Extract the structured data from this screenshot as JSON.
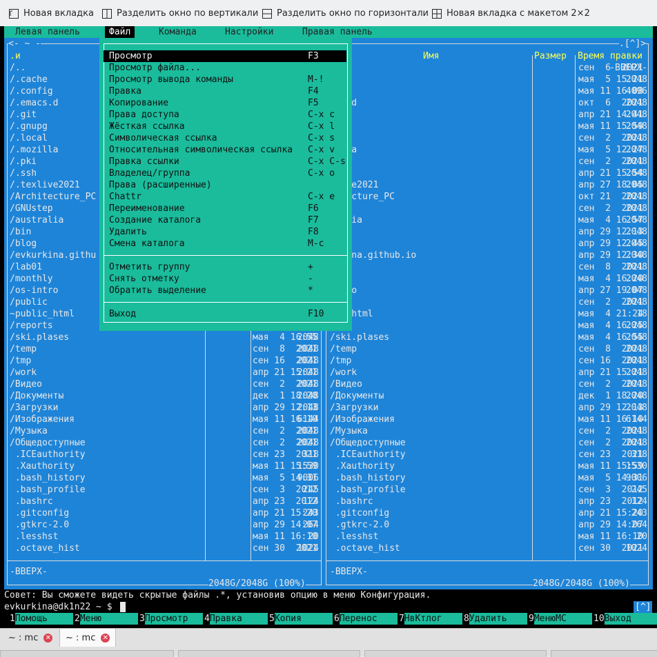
{
  "toolbar": {
    "new_tab": "Новая вкладка",
    "split_vertical": "Разделить окно по вертикали",
    "split_horizontal": "Разделить окно по горизонтали",
    "new_tab_layout": "Новая вкладка с макетом 2×2"
  },
  "menubar": {
    "left_panel": "Левая панель",
    "file": "Файл",
    "command": "Команда",
    "settings": "Настройки",
    "right_panel": "Правая панель"
  },
  "file_menu": [
    {
      "label": "Просмотр",
      "key": "F3"
    },
    {
      "label": "Просмотр файла...",
      "key": ""
    },
    {
      "label": "Просмотр вывода команды",
      "key": "M-!"
    },
    {
      "label": "Правка",
      "key": "F4"
    },
    {
      "label": "Копирование",
      "key": "F5"
    },
    {
      "label": "Права доступа",
      "key": "C-x c"
    },
    {
      "label": "Жёсткая ссылка",
      "key": "C-x l"
    },
    {
      "label": "Символическая ссылка",
      "key": "C-x s"
    },
    {
      "label": "Относительная символическая ссылка",
      "key": "C-x v"
    },
    {
      "label": "Правка ссылки",
      "key": "C-x C-s"
    },
    {
      "label": "Владелец/группа",
      "key": "C-x o"
    },
    {
      "label": "Права (расширенные)",
      "key": ""
    },
    {
      "label": "Chattr",
      "key": "C-x e"
    },
    {
      "label": "Переименование",
      "key": "F6"
    },
    {
      "label": "Создание каталога",
      "key": "F7"
    },
    {
      "label": "Удалить",
      "key": "F8"
    },
    {
      "label": "Смена каталога",
      "key": "M-c"
    },
    {
      "label": "Отметить группу",
      "key": "+"
    },
    {
      "label": "Снять отметку",
      "key": "-"
    },
    {
      "label": "Обратить выделение",
      "key": "*"
    },
    {
      "label": "Выход",
      "key": "F10"
    }
  ],
  "left_panel": {
    "path": "~",
    "name_header": ".и",
    "entries": [
      {
        "name": "/..",
        "size": "",
        "date": ""
      },
      {
        "name": "/.cache",
        "size": "",
        "date": ""
      },
      {
        "name": "/.config",
        "size": "",
        "date": ""
      },
      {
        "name": "/.emacs.d",
        "size": "",
        "date": ""
      },
      {
        "name": "/.git",
        "size": "",
        "date": ""
      },
      {
        "name": "/.gnupg",
        "size": "",
        "date": ""
      },
      {
        "name": "/.local",
        "size": "",
        "date": ""
      },
      {
        "name": "/.mozilla",
        "size": "",
        "date": ""
      },
      {
        "name": "/.pki",
        "size": "",
        "date": ""
      },
      {
        "name": "/.ssh",
        "size": "",
        "date": ""
      },
      {
        "name": "/.texlive2021",
        "size": "",
        "date": ""
      },
      {
        "name": "/Architecture_PC",
        "size": "",
        "date": ""
      },
      {
        "name": "/GNUstep",
        "size": "",
        "date": ""
      },
      {
        "name": "/australia",
        "size": "",
        "date": ""
      },
      {
        "name": "/bin",
        "size": "",
        "date": ""
      },
      {
        "name": "/blog",
        "size": "",
        "date": ""
      },
      {
        "name": "/evkurkina.githu",
        "size": "",
        "date": ""
      },
      {
        "name": "/lab01",
        "size": "",
        "date": ""
      },
      {
        "name": "/monthly",
        "size": "",
        "date": ""
      },
      {
        "name": "/os-intro",
        "size": "",
        "date": ""
      },
      {
        "name": "/public",
        "size": "",
        "date": ""
      },
      {
        "name": "~public_html",
        "size": "",
        "date": ""
      },
      {
        "name": "/reports",
        "size": "",
        "date": ""
      },
      {
        "name": "/ski.plases",
        "size": "2048",
        "date": "мая  4 16:55"
      },
      {
        "name": "/temp",
        "size": "2048",
        "date": "сен  8  2021"
      },
      {
        "name": "/tmp",
        "size": "2048",
        "date": "сен 16  2021"
      },
      {
        "name": "/work",
        "size": "2048",
        "date": "апр 21 15:21"
      },
      {
        "name": "/Видео",
        "size": "2048",
        "date": "сен  2  2021"
      },
      {
        "name": "/Документы",
        "size": "2048",
        "date": "дек  1 18:20"
      },
      {
        "name": "/Загрузки",
        "size": "2048",
        "date": "апр 29 12:13"
      },
      {
        "name": "/Изображения",
        "size": "6144",
        "date": "мая 11 16:10"
      },
      {
        "name": "/Музыка",
        "size": "2048",
        "date": "сен  2  2021"
      },
      {
        "name": "/Общедоступные",
        "size": "2048",
        "date": "сен  2  2021"
      },
      {
        "name": " .ICEauthority",
        "size": "318",
        "date": "сен 23  2021"
      },
      {
        "name": " .Xauthority",
        "size": "1530",
        "date": "мая 11 15:59"
      },
      {
        "name": " .bash_history",
        "size": "9006",
        "date": "мая  5 14:31"
      },
      {
        "name": " .bash_profile",
        "size": "245",
        "date": "сен  3  2012"
      },
      {
        "name": " .bashrc",
        "size": "124",
        "date": "апр 23  2012"
      },
      {
        "name": " .gitconfig",
        "size": "243",
        "date": "апр 21 15:20"
      },
      {
        "name": " .gtkrc-2.0",
        "size": "264",
        "date": "апр 29 14:07"
      },
      {
        "name": " .lesshst",
        "size": "20",
        "date": "мая 11 16:10"
      },
      {
        "name": " .octave_hist",
        "size": "1024",
        "date": "сен 30  2021"
      }
    ],
    "status": "-ВВЕРХ-",
    "disk": "2048G/2048G (100%)"
  },
  "right_panel": {
    "path_marker": ".[^]>",
    "col_name": "Имя",
    "col_size": "Размер",
    "col_time": "Время правки",
    "entries": [
      {
        "name": "",
        "size": "-ВВЕРХ-",
        "date": "сен  6  2021"
      },
      {
        "name": "che",
        "size": "2048",
        "date": "мая  5 15:21"
      },
      {
        "name": "nfig",
        "size": "4096",
        "date": "мая 11 16:08"
      },
      {
        "name": "acs.d",
        "size": "2048",
        "date": "окт  6  2021"
      },
      {
        "name": "t",
        "size": "2048",
        "date": "апр 21 14:41"
      },
      {
        "name": "upg",
        "size": "2048",
        "date": "мая 11 15:59"
      },
      {
        "name": "cal",
        "size": "2048",
        "date": "сен  2  2021"
      },
      {
        "name": "zilla",
        "size": "2048",
        "date": "мая  5 12:27"
      },
      {
        "name": "i",
        "size": "2048",
        "date": "сен  2  2021"
      },
      {
        "name": "h",
        "size": "2048",
        "date": "апр 21 15:54"
      },
      {
        "name": "xlive2021",
        "size": "2048",
        "date": "апр 27 18:05"
      },
      {
        "name": "hitecture_PC",
        "size": "2048",
        "date": "окт 21  2021"
      },
      {
        "name": "step",
        "size": "2048",
        "date": "сен  2  2021"
      },
      {
        "name": "tralia",
        "size": "2048",
        "date": "мая  4 16:57"
      },
      {
        "name": "",
        "size": "2048",
        "date": "апр 29 12:13"
      },
      {
        "name": "g",
        "size": "2048",
        "date": "апр 29 12:45"
      },
      {
        "name": "urkina.github.io",
        "size": "2048",
        "date": "апр 29 12:30"
      },
      {
        "name": "01",
        "size": "2048",
        "date": "сен  8  2021"
      },
      {
        "name": "thly",
        "size": "2048",
        "date": "мая  4 16:20"
      },
      {
        "name": "intro",
        "size": "2048",
        "date": "апр 27 19:07"
      },
      {
        "name": "lic",
        "size": "2048",
        "date": "сен  2  2021"
      },
      {
        "name": "lic_html",
        "size": "18",
        "date": "мая  4 21:24"
      },
      {
        "name": "orts",
        "size": "2048",
        "date": "мая  4 16:25"
      },
      {
        "name": "/ski.plases",
        "size": "2048",
        "date": "мая  4 16:55"
      },
      {
        "name": "/temp",
        "size": "2048",
        "date": "сен  8  2021"
      },
      {
        "name": "/tmp",
        "size": "2048",
        "date": "сен 16  2021"
      },
      {
        "name": "/work",
        "size": "2048",
        "date": "апр 21 15:21"
      },
      {
        "name": "/Видео",
        "size": "2048",
        "date": "сен  2  2021"
      },
      {
        "name": "/Документы",
        "size": "2048",
        "date": "дек  1 18:20"
      },
      {
        "name": "/Загрузки",
        "size": "2048",
        "date": "апр 29 12:13"
      },
      {
        "name": "/Изображения",
        "size": "6144",
        "date": "мая 11 16:10"
      },
      {
        "name": "/Музыка",
        "size": "2048",
        "date": "сен  2  2021"
      },
      {
        "name": "/Общедоступные",
        "size": "2048",
        "date": "сен  2  2021"
      },
      {
        "name": " .ICEauthority",
        "size": "318",
        "date": "сен 23  2021"
      },
      {
        "name": " .Xauthority",
        "size": "1530",
        "date": "мая 11 15:59"
      },
      {
        "name": " .bash_history",
        "size": "9006",
        "date": "мая  5 14:31"
      },
      {
        "name": " .bash_profile",
        "size": "245",
        "date": "сен  3  2012"
      },
      {
        "name": " .bashrc",
        "size": "124",
        "date": "апр 23  2012"
      },
      {
        "name": " .gitconfig",
        "size": "243",
        "date": "апр 21 15:20"
      },
      {
        "name": " .gtkrc-2.0",
        "size": "264",
        "date": "апр 29 14:07"
      },
      {
        "name": " .lesshst",
        "size": "20",
        "date": "мая 11 16:10"
      },
      {
        "name": " .octave_hist",
        "size": "1024",
        "date": "сен 30  2021"
      }
    ],
    "status": "-ВВЕРХ-",
    "disk": "2048G/2048G (100%)"
  },
  "hint": "Совет: Вы сможете видеть скрытые файлы .*, установив опцию в меню Конфигурация.",
  "prompt": "evkurkina@dk1n22 ~ $",
  "scroll_marker": "[^]",
  "fkeys": [
    {
      "num": "1",
      "label": "Помощь"
    },
    {
      "num": "2",
      "label": "Меню"
    },
    {
      "num": "3",
      "label": "Просмотр"
    },
    {
      "num": "4",
      "label": "Правка"
    },
    {
      "num": "5",
      "label": "Копия"
    },
    {
      "num": "6",
      "label": "Перенос"
    },
    {
      "num": "7",
      "label": "НвКтлог"
    },
    {
      "num": "8",
      "label": "Удалить"
    },
    {
      "num": "9",
      "label": "МенюMC"
    },
    {
      "num": "10",
      "label": "Выход"
    }
  ],
  "tabs": [
    {
      "label": "~ : mc"
    },
    {
      "label": "~ : mc"
    }
  ],
  "colors": {
    "panel_bg": "#1e84d8",
    "menu_bg": "#1abc9c",
    "hotkey": "#ffff55",
    "selection_bg": "#000000"
  }
}
